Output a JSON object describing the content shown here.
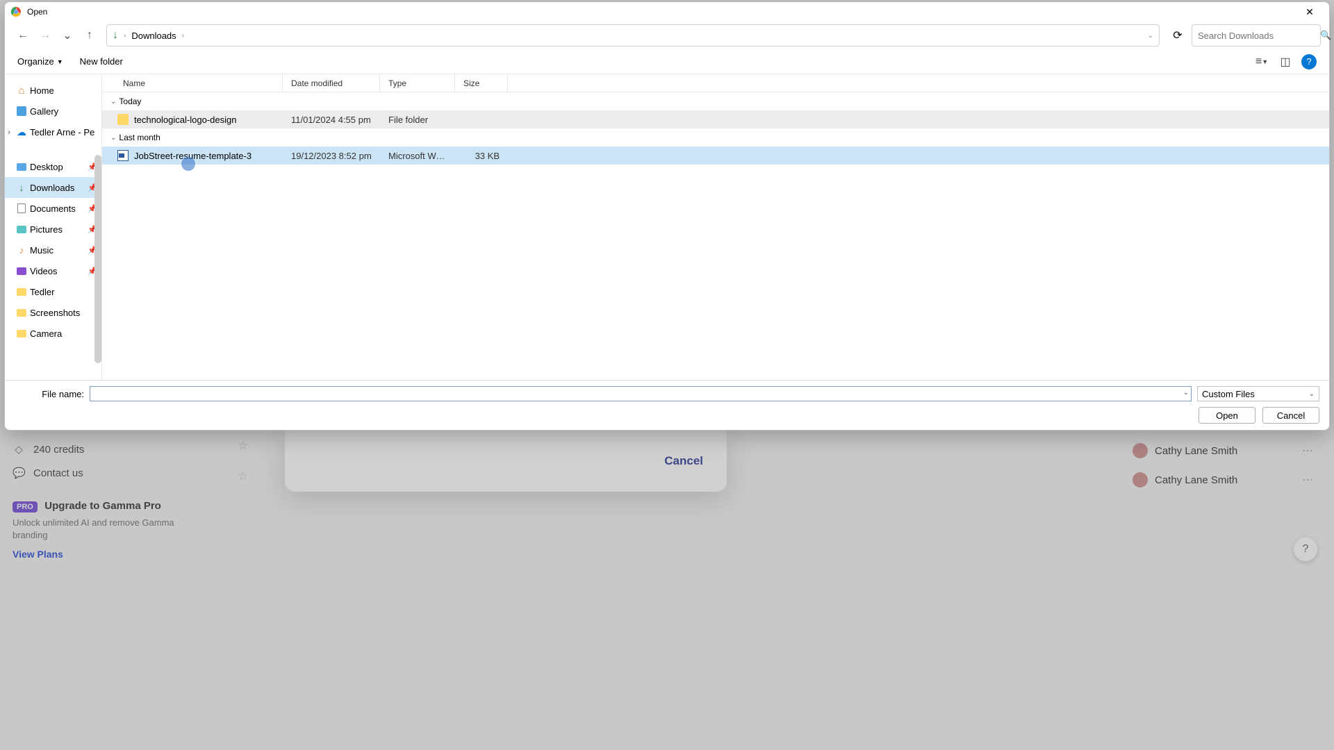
{
  "dialog": {
    "title": "Open",
    "close_tooltip": "Close"
  },
  "nav": {
    "breadcrumb": "Downloads",
    "search_placeholder": "Search Downloads"
  },
  "toolbar": {
    "organize": "Organize",
    "new_folder": "New folder"
  },
  "sidebar": {
    "home": "Home",
    "gallery": "Gallery",
    "onedrive": "Tedler Arne - Pe",
    "desktop": "Desktop",
    "downloads": "Downloads",
    "documents": "Documents",
    "pictures": "Pictures",
    "music": "Music",
    "videos": "Videos",
    "tedler": "Tedler",
    "screenshots": "Screenshots",
    "camera": "Camera"
  },
  "columns": {
    "name": "Name",
    "date": "Date modified",
    "type": "Type",
    "size": "Size"
  },
  "groups": {
    "today": "Today",
    "last_month": "Last month"
  },
  "files": {
    "r0": {
      "name": "technological-logo-design",
      "date": "11/01/2024 4:55 pm",
      "type": "File folder",
      "size": ""
    },
    "r1": {
      "name": "JobStreet-resume-template-3",
      "date": "19/12/2023 8:52 pm",
      "type": "Microsoft Word D...",
      "size": "33 KB"
    }
  },
  "bottom": {
    "file_name_label": "File name:",
    "file_name_value": "",
    "filter": "Custom Files",
    "open": "Open",
    "cancel": "Cancel"
  },
  "bg": {
    "credits": "240 credits",
    "contact": "Contact us",
    "pro_badge": "PRO",
    "pro_title": "Upgrade to Gamma Pro",
    "pro_desc": "Unlock unlimited AI and remove Gamma branding",
    "view_plans": "View Plans",
    "modal_cancel": "Cancel",
    "user1": "Cathy Lane Smith",
    "user2": "Cathy Lane Smith"
  }
}
